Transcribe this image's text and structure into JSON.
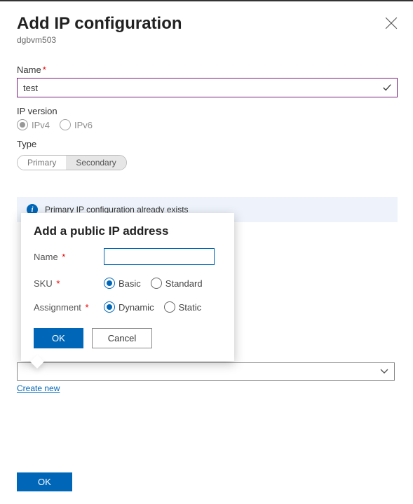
{
  "panel": {
    "title": "Add IP configuration",
    "subtitle": "dgbvm503",
    "name_label": "Name",
    "name_value": "test",
    "ipversion_label": "IP version",
    "ipv4": "IPv4",
    "ipv6": "IPv6",
    "type_label": "Type",
    "type_primary": "Primary",
    "type_secondary": "Secondary",
    "info_text": "Primary IP configuration already exists",
    "create_new": "Create new",
    "ok": "OK"
  },
  "popup": {
    "title": "Add a public IP address",
    "name_label": "Name",
    "name_value": "",
    "sku_label": "SKU",
    "sku_basic": "Basic",
    "sku_standard": "Standard",
    "assignment_label": "Assignment",
    "assignment_dynamic": "Dynamic",
    "assignment_static": "Static",
    "ok": "OK",
    "cancel": "Cancel"
  }
}
